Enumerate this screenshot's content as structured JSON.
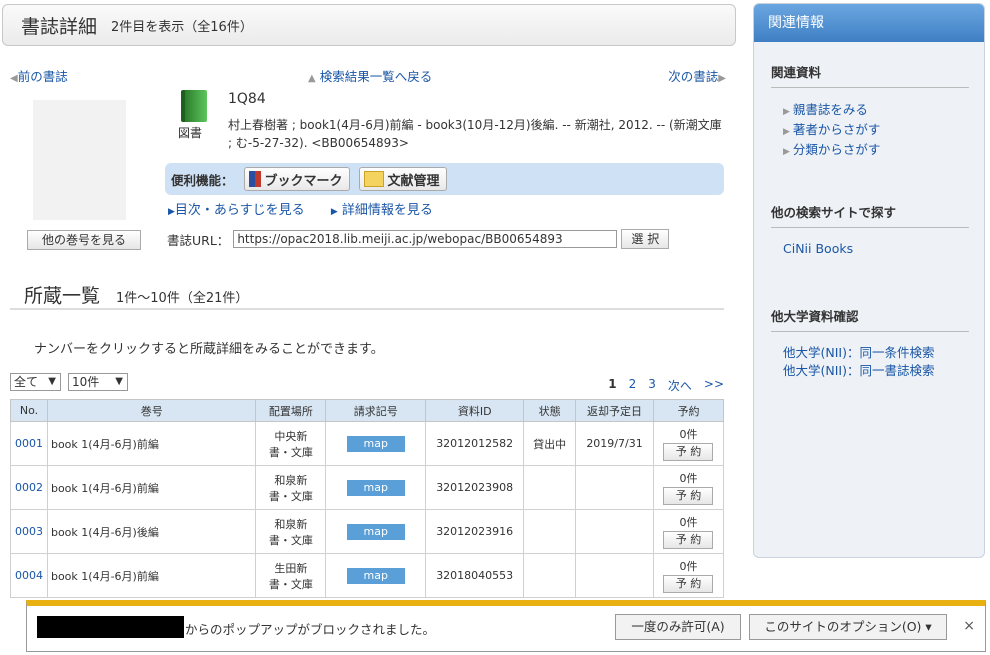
{
  "header": {
    "title": "書誌詳細",
    "count": "2件目を表示（全16件）"
  },
  "nav": {
    "prev": "前の書誌",
    "back": "検索結果一覧へ戻る",
    "next": "次の書誌"
  },
  "book": {
    "type_label": "図書",
    "title": "1Q84",
    "description": "村上春樹著 ; book1(4月-6月)前編 - book3(10月-12月)後編. -- 新潮社, 2012. -- (新潮文庫 ; む-5-27-32). <BB00654893>",
    "other_volumes_button": "他の巻号を見る"
  },
  "tools": {
    "label": "便利機能：",
    "bookmark": "ブックマーク",
    "docmanage": "文献管理"
  },
  "links": {
    "toc": "目次・あらすじを見る",
    "detail": "詳細情報を見る"
  },
  "url": {
    "label": "書誌URL：",
    "value": "https://opac2018.lib.meiji.ac.jp/webopac/BB00654893",
    "select_button": "選 択"
  },
  "holdings": {
    "title": "所蔵一覧",
    "count": "1件～10件（全21件）",
    "hint": "ナンバーをクリックすると所蔵詳細をみることができます。",
    "filter_select": "全て",
    "perpage_select": "10件",
    "pager": {
      "p1": "1",
      "p2": "2",
      "p3": "3",
      "next": "次へ",
      "last": ">>"
    },
    "columns": [
      "No.",
      "巻号",
      "配置場所",
      "請求記号",
      "資料ID",
      "状態",
      "返却予定日",
      "予約"
    ],
    "rows": [
      {
        "no": "0001",
        "vol": "book 1(4月-6月)前編",
        "loc1": "中央新",
        "loc2": "書・文庫",
        "map": "map",
        "id": "32012012582",
        "status": "貸出中",
        "due": "2019/7/31",
        "rsv_count": "0件",
        "rsv_btn": "予 約"
      },
      {
        "no": "0002",
        "vol": "book 1(4月-6月)前編",
        "loc1": "和泉新",
        "loc2": "書・文庫",
        "map": "map",
        "id": "32012023908",
        "status": "",
        "due": "",
        "rsv_count": "0件",
        "rsv_btn": "予 約"
      },
      {
        "no": "0003",
        "vol": "book 1(4月-6月)後編",
        "loc1": "和泉新",
        "loc2": "書・文庫",
        "map": "map",
        "id": "32012023916",
        "status": "",
        "due": "",
        "rsv_count": "0件",
        "rsv_btn": "予 約"
      },
      {
        "no": "0004",
        "vol": "book 1(4月-6月)前編",
        "loc1": "生田新",
        "loc2": "書・文庫",
        "map": "map",
        "id": "32018040553",
        "status": "",
        "due": "",
        "rsv_count": "0件",
        "rsv_btn": "予 約"
      }
    ]
  },
  "sidebar": {
    "title": "関連情報",
    "related": {
      "heading": "関連資料",
      "items": [
        "親書誌をみる",
        "著者からさがす",
        "分類からさがす"
      ]
    },
    "other_sites": {
      "heading": "他の検索サイトで探す",
      "items": [
        "CiNii Books"
      ]
    },
    "other_univ": {
      "heading": "他大学資料確認",
      "items": [
        "他大学(NII)：同一条件検索",
        "他大学(NII)：同一書誌検索"
      ]
    }
  },
  "popup": {
    "message": "からのポップアップがブロックされました。",
    "allow_once": "一度のみ許可(A)",
    "options": "このサイトのオプション(O) ▾",
    "close": "×"
  }
}
